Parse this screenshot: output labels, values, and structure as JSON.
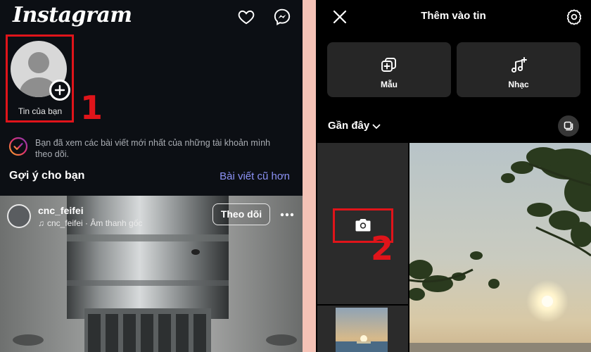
{
  "left": {
    "logo": "Instagram",
    "header_icons": [
      "heart-icon",
      "messenger-icon"
    ],
    "story": {
      "label": "Tin của bạn",
      "annotation_number": "1"
    },
    "caught_up_text": "Bạn đã xem các bài viết mới nhất của những tài khoản mình theo dõi.",
    "suggestions": {
      "title": "Gợi ý cho bạn",
      "link": "Bài viết cũ hơn"
    },
    "post": {
      "username": "cnc_feifei",
      "audio": "cnc_feifei · Âm thanh gốc",
      "follow_label": "Theo dõi"
    }
  },
  "right": {
    "title": "Thêm vào tin",
    "cards": [
      {
        "label": "Mẫu",
        "icon": "template-icon"
      },
      {
        "label": "Nhạc",
        "icon": "music-icon"
      }
    ],
    "recent_label": "Gần đây",
    "annotation_number": "2"
  },
  "colors": {
    "highlight": "#e0141a",
    "link": "#8c92f5",
    "left_background": "#0c0f14",
    "right_background": "#000000",
    "divider": "#f4c2b6"
  }
}
